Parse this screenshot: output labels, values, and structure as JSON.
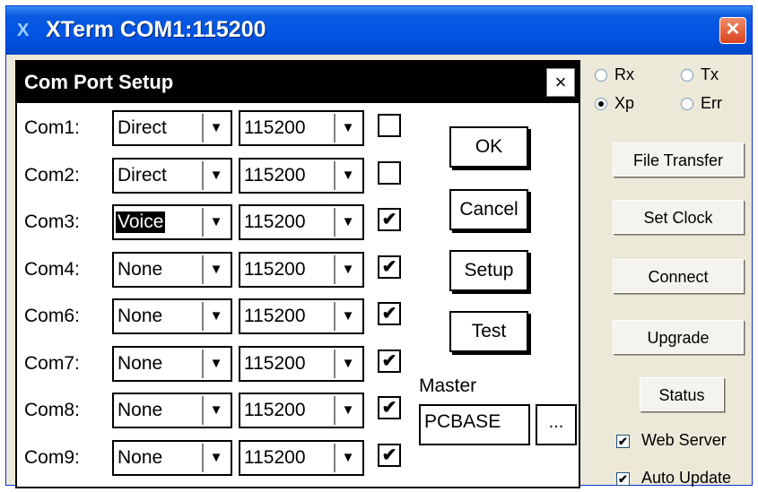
{
  "window": {
    "title": "XTerm COM1:115200",
    "app_icon": "x-icon",
    "close_icon": "close-icon"
  },
  "dialog": {
    "title": "Com Port Setup",
    "close_label": "×",
    "ports": [
      {
        "label": "Com1:",
        "mode": "Direct",
        "baud": "115200",
        "enabled": false
      },
      {
        "label": "Com2:",
        "mode": "Direct",
        "baud": "115200",
        "enabled": false
      },
      {
        "label": "Com3:",
        "mode": "Voice",
        "baud": "115200",
        "enabled": true,
        "focused": true
      },
      {
        "label": "Com4:",
        "mode": "None",
        "baud": "115200",
        "enabled": true
      },
      {
        "label": "Com6:",
        "mode": "None",
        "baud": "115200",
        "enabled": true
      },
      {
        "label": "Com7:",
        "mode": "None",
        "baud": "115200",
        "enabled": true
      },
      {
        "label": "Com8:",
        "mode": "None",
        "baud": "115200",
        "enabled": true
      },
      {
        "label": "Com9:",
        "mode": "None",
        "baud": "115200",
        "enabled": true
      }
    ],
    "buttons": {
      "ok": "OK",
      "cancel": "Cancel",
      "setup": "Setup",
      "test": "Test"
    },
    "master": {
      "label": "Master",
      "value": "PCBASE",
      "browse": "..."
    }
  },
  "side_panel": {
    "radios": [
      {
        "label": "Rx",
        "checked": false
      },
      {
        "label": "Tx",
        "checked": false
      },
      {
        "label": "Xp",
        "checked": true
      },
      {
        "label": "Err",
        "checked": false
      }
    ],
    "buttons": [
      "File Transfer",
      "Set Clock",
      "Connect",
      "Upgrade",
      "Status"
    ],
    "checkboxes": [
      {
        "label": "Web Server",
        "checked": true
      },
      {
        "label": "Auto Update",
        "checked": true
      }
    ]
  },
  "glyphs": {
    "check": "✔",
    "dropdown": "▼"
  }
}
